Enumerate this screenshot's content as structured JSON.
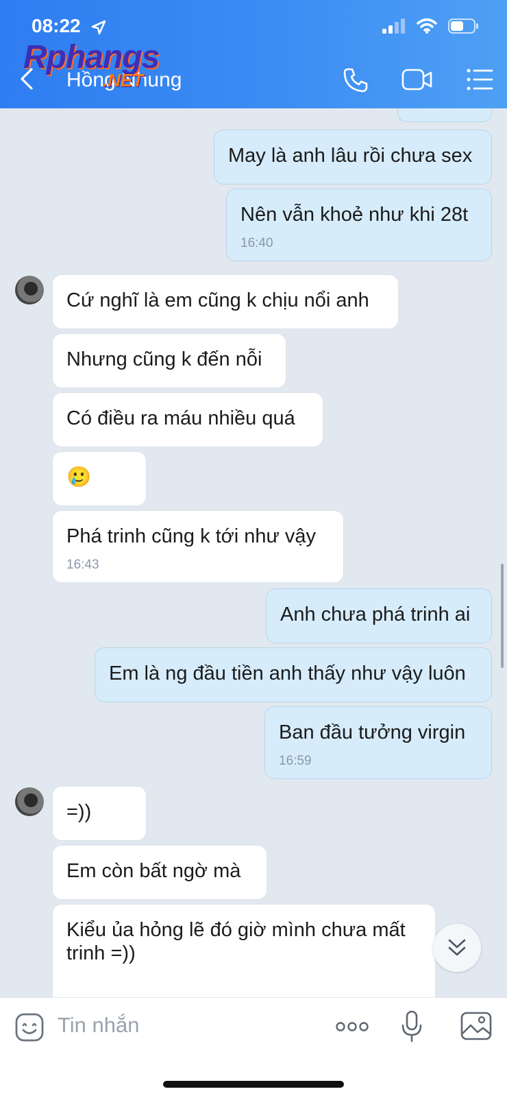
{
  "status_bar": {
    "time": "08:22"
  },
  "header": {
    "contact_name": "Hồng Nhung",
    "watermark_main": "Rphangs",
    "watermark_sub": ".NET"
  },
  "messages": [
    {
      "id": "m1",
      "side": "out",
      "text": "May là anh lâu rồi chưa sex",
      "time": ""
    },
    {
      "id": "m2",
      "side": "out",
      "text": "Nên vẫn khoẻ như khi 28t",
      "time": "16:40"
    },
    {
      "id": "m3",
      "side": "in",
      "text": "Cứ nghĩ là em cũng k chịu nổi anh",
      "time": ""
    },
    {
      "id": "m4",
      "side": "in",
      "text": "Nhưng cũng k đến nỗi",
      "time": ""
    },
    {
      "id": "m5",
      "side": "in",
      "text": "Có điều ra máu nhiều quá",
      "time": ""
    },
    {
      "id": "m6",
      "side": "in",
      "text": "🥲",
      "time": ""
    },
    {
      "id": "m7",
      "side": "in",
      "text": "Phá trinh cũng k tới như vậy",
      "time": "16:43"
    },
    {
      "id": "m8",
      "side": "out",
      "text": "Anh chưa phá trinh ai",
      "time": ""
    },
    {
      "id": "m9",
      "side": "out",
      "text": "Em là ng đầu tiền anh thấy như vậy luôn",
      "time": ""
    },
    {
      "id": "m10",
      "side": "out",
      "text": "Ban đầu tưởng  virgin",
      "time": "16:59"
    },
    {
      "id": "m11",
      "side": "in",
      "text": "=))",
      "time": ""
    },
    {
      "id": "m12",
      "side": "in",
      "text": "Em còn bất ngờ mà",
      "time": ""
    },
    {
      "id": "m13",
      "side": "in",
      "text": "Kiểu ủa hỏng lẽ đó giờ mình chưa mất trinh =))",
      "time": ""
    }
  ],
  "composer": {
    "placeholder": "Tin nhắn"
  },
  "icons": {
    "back": "chevron-left-icon",
    "call": "phone-icon",
    "video": "video-camera-icon",
    "menu": "list-menu-icon",
    "sticker": "sticker-smile-icon",
    "more": "more-dots-icon",
    "mic": "microphone-icon",
    "gallery": "image-gallery-icon",
    "scroll_down": "double-chevron-down-icon"
  },
  "colors": {
    "header": "#3a8bf3",
    "outgoing_bubble": "#d6ecfb",
    "incoming_bubble": "#ffffff",
    "chat_bg": "#e2e8f0"
  }
}
